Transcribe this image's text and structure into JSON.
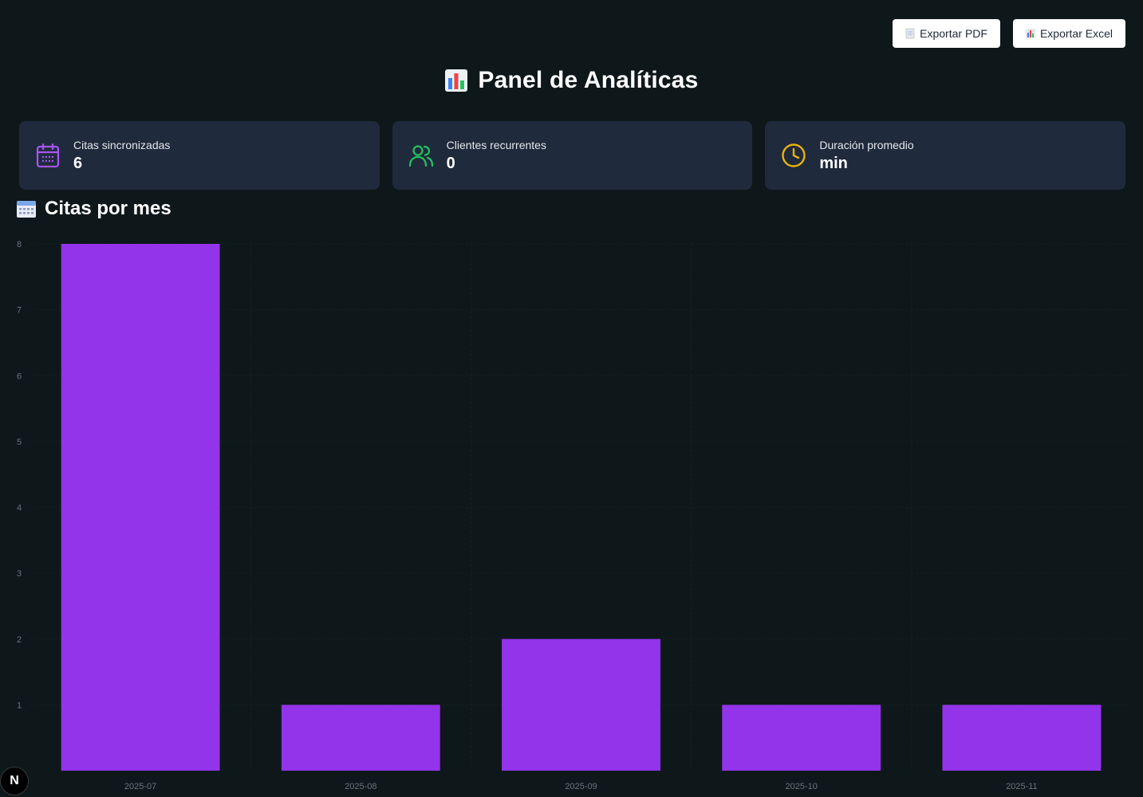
{
  "toolbar": {
    "export_pdf_label": "Exportar PDF",
    "export_excel_label": "Exportar Excel"
  },
  "page": {
    "title": "Panel de Analíticas",
    "title_icon": "bar-chart-icon"
  },
  "cards": [
    {
      "label": "Citas sincronizadas",
      "value": "6",
      "icon": "calendar-icon",
      "icon_color": "#a855f7"
    },
    {
      "label": "Clientes recurrentes",
      "value": "0",
      "icon": "users-icon",
      "icon_color": "#22c55e"
    },
    {
      "label": "Duración promedio",
      "value": "min",
      "icon": "clock-icon",
      "icon_color": "#eab308"
    }
  ],
  "section": {
    "title": "Citas por mes",
    "icon": "calendar-grid-icon"
  },
  "badge": {
    "letter": "N"
  },
  "colors": {
    "bar": "#9333ea",
    "background": "#0e181a",
    "card": "#1f2a3c"
  },
  "chart_data": {
    "type": "bar",
    "title": "",
    "xlabel": "",
    "ylabel": "",
    "categories": [
      "2025-07",
      "2025-08",
      "2025-09",
      "2025-10",
      "2025-11"
    ],
    "values": [
      8,
      1,
      2,
      1,
      1
    ],
    "ylim": [
      0,
      8
    ],
    "yticks": [
      1,
      2,
      3,
      4,
      5,
      6,
      7,
      8
    ],
    "grid": true,
    "legend": "none"
  }
}
